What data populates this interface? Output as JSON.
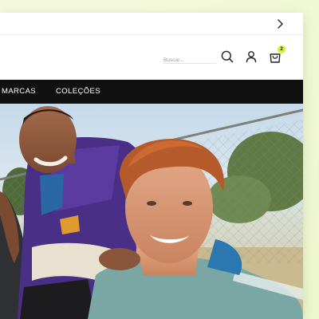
{
  "topbar": {
    "next_icon": "chevron-right-icon"
  },
  "header": {
    "search": {
      "placeholder": "Buscar...",
      "value": ""
    },
    "icons": [
      "search-icon",
      "user-icon",
      "shopping-bag-icon"
    ],
    "cart_count": "2"
  },
  "nav": {
    "items": [
      {
        "label": "MARCAS"
      },
      {
        "label": "COLEÇÕES"
      }
    ]
  },
  "colors": {
    "background": "#f1f7d6",
    "nav_bg": "#111111",
    "badge": "#d8f03c"
  }
}
